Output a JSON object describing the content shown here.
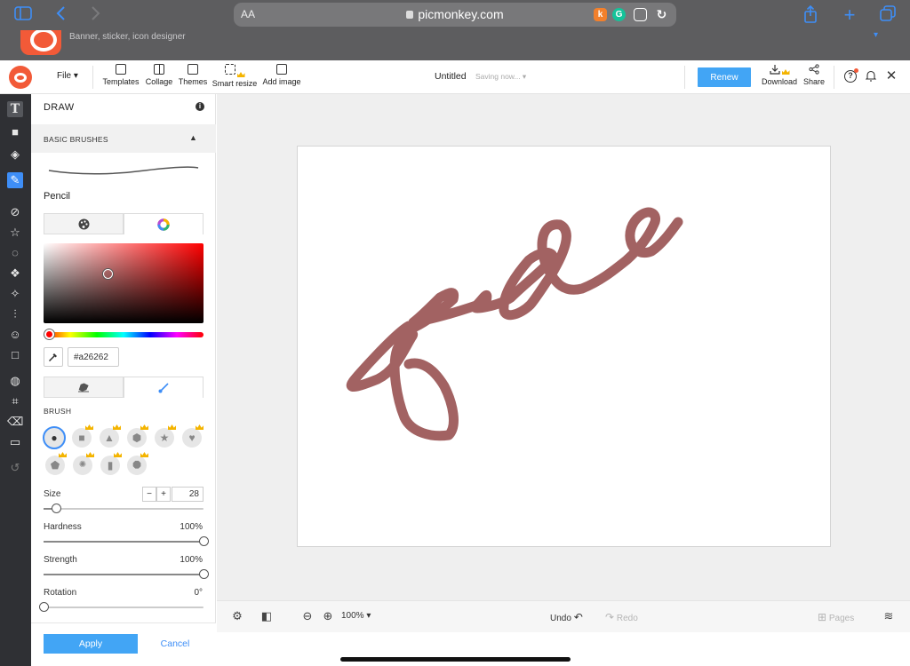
{
  "browser": {
    "aa_label": "AA",
    "url": "picmonkey.com",
    "app_banner_subtitle": "Banner, sticker, icon designer"
  },
  "toolbar": {
    "file_label": "File",
    "tools": [
      {
        "label": "Templates",
        "icon": "templates-icon"
      },
      {
        "label": "Collage",
        "icon": "collage-icon"
      },
      {
        "label": "Themes",
        "icon": "themes-icon"
      },
      {
        "label": "Smart resize",
        "icon": "smart-resize-icon",
        "premium": true
      },
      {
        "label": "Add image",
        "icon": "add-image-icon"
      }
    ],
    "doc_title": "Untitled",
    "saving_status": "Saving now...",
    "renew_label": "Renew",
    "download_label": "Download",
    "share_label": "Share"
  },
  "panel": {
    "title": "DRAW",
    "section": "BASIC BRUSHES",
    "brush_name": "Pencil",
    "hex_value": "#a26262",
    "brush_section_label": "BRUSH",
    "size_label": "Size",
    "size_value": "28",
    "hardness_label": "Hardness",
    "hardness_value": "100%",
    "strength_label": "Strength",
    "strength_value": "100%",
    "rotation_label": "Rotation",
    "rotation_value": "0°",
    "apply_label": "Apply",
    "cancel_label": "Cancel"
  },
  "sliders": {
    "size_fraction": 0.08,
    "hardness_fraction": 1.0,
    "strength_fraction": 1.0,
    "rotation_fraction": 0.0
  },
  "canvas": {
    "stroke_color": "#a26262"
  },
  "bottom": {
    "zoom": "100%",
    "undo_label": "Undo",
    "redo_label": "Redo",
    "pages_label": "Pages"
  },
  "colors": {
    "accent": "#42a5f5",
    "brand": "#f25a38",
    "rail_bg": "#2f3034"
  }
}
